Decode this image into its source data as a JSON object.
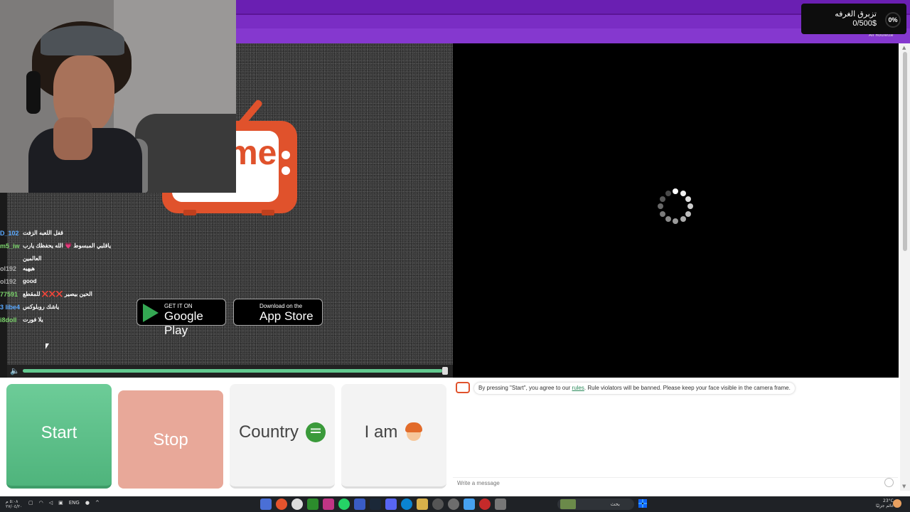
{
  "banner": {
    "donation_title": "تزبرق الغرفه",
    "donation_amount": "0/500$",
    "donation_percent": "0%",
    "all_stream_label": "All Roulette"
  },
  "left_video": {
    "logo_text": "me",
    "google_play": {
      "small": "GET IT ON",
      "big": "Google Play"
    },
    "app_store": {
      "small": "Download on the",
      "big": "App Store"
    },
    "volume_level": 0.99
  },
  "chat_overlay": [
    {
      "user": "D_102",
      "user_color": "#5aa9ff",
      "message": "قفل اللعبه الزفت"
    },
    {
      "user": "m5_iw",
      "user_color": "#7bd36b",
      "message": "ياقلبي المبسوط 💗 الله يحفظك يارب",
      "cont": "العالمين"
    },
    {
      "user": "ol192",
      "user_color": "#aaaaaa",
      "message": "هيهيه"
    },
    {
      "user": "ol192",
      "user_color": "#aaaaaa",
      "message": "good"
    },
    {
      "user": "77591",
      "user_color": "#7bd36b",
      "message": "الحين بيصير ❌❌❌ للمقطع"
    },
    {
      "user": "3 libe4",
      "user_color": "#5aa9ff",
      "message": "ياشك روبلوكس"
    },
    {
      "user": "i8doll",
      "user_color": "#7bd36b",
      "message": "يلا فورت"
    }
  ],
  "controls": {
    "start_label": "Start",
    "stop_label": "Stop",
    "country_label": "Country",
    "iam_label": "I am"
  },
  "chat_panel": {
    "system_message_pre": "By pressing \"Start\", you agree to our ",
    "system_message_link": "rules",
    "system_message_post": ". Rule violators will be banned. Please keep your face visible in the camera frame.",
    "input_placeholder": "Write a message"
  },
  "taskbar": {
    "time": "٥:٠٨ م",
    "date": "٢٧/٠٤/٢٠",
    "language": "ENG",
    "search_placeholder": "بحث",
    "weather_temp": "23°C",
    "weather_desc": "غائم جزئيًا"
  },
  "colors": {
    "banner_purple": "#7a2dc4",
    "start_green": "#5fc18a",
    "stop_salmon": "#e8a899",
    "logo_orange": "#e0522c"
  }
}
